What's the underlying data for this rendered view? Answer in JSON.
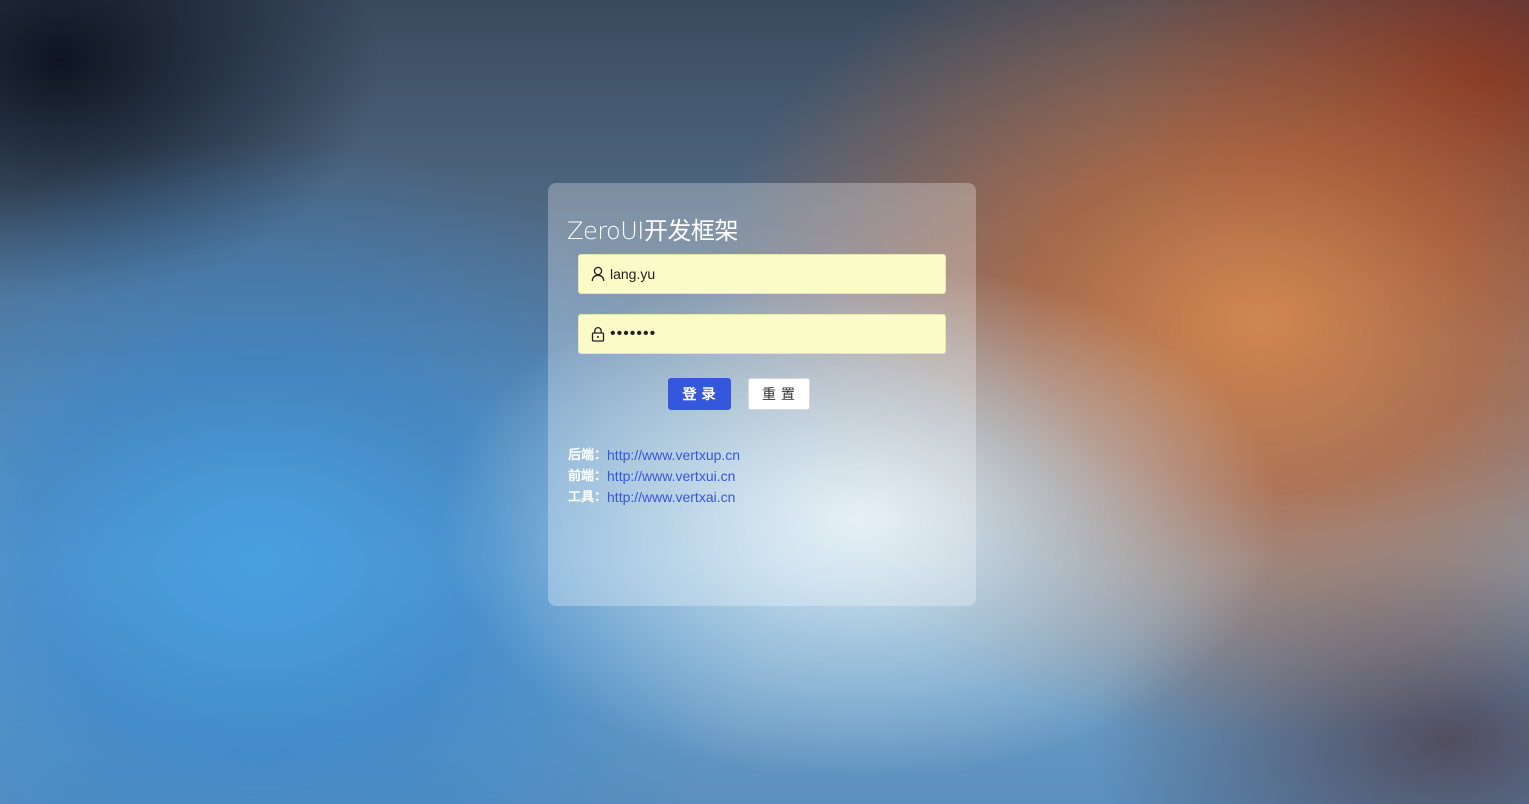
{
  "login_card": {
    "title": "ZeroUI开发框架",
    "username": {
      "value": "lang.yu",
      "icon": "user-icon"
    },
    "password": {
      "value": "•••••••",
      "icon": "lock-icon"
    },
    "login_label": "登录",
    "reset_label": "重置",
    "links": [
      {
        "label": "后端：",
        "url": "http://www.vertxup.cn"
      },
      {
        "label": "前端：",
        "url": "http://www.vertxui.cn"
      },
      {
        "label": "工具：",
        "url": "http://www.vertxai.cn"
      }
    ]
  },
  "colors": {
    "primary": "#3557db",
    "field_bg": "#fbfbc8"
  }
}
